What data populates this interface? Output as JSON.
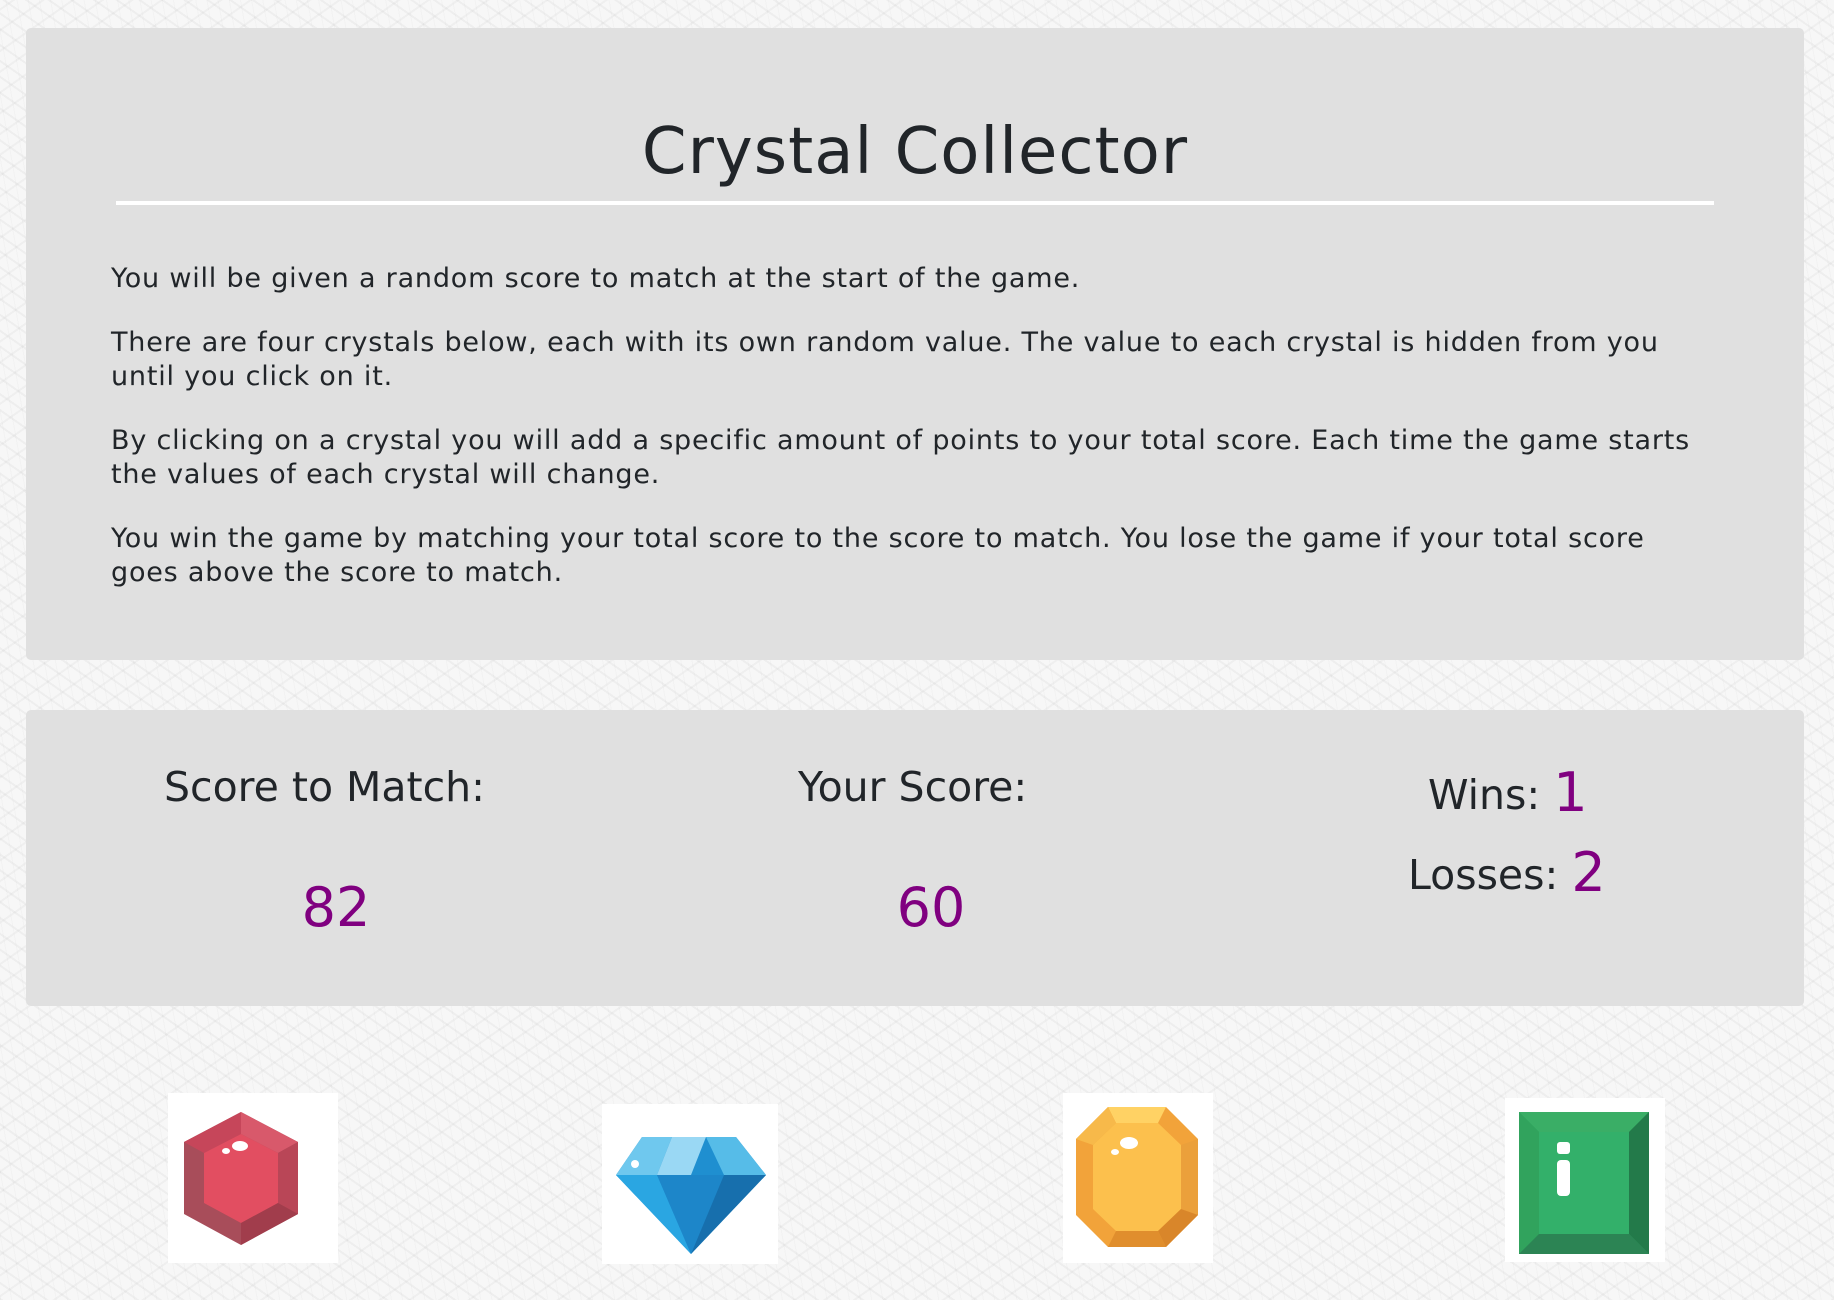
{
  "game": {
    "title": "Crystal Collector",
    "instructions": [
      "You will be given a random score to match at the start of the game.",
      "There are four crystals below, each with its own random value. The value to each crystal is hidden from you until you click on it.",
      "By clicking on a crystal you will add a specific amount of points to your total score. Each time the game starts the values of each crystal will change.",
      "You win the game by matching your total score to the score to match. You lose the game if your total score goes above the score to match."
    ]
  },
  "scoreboard": {
    "target_label": "Score to Match:",
    "target_value": "82",
    "score_label": "Your Score:",
    "score_value": "60",
    "wins_label": "Wins:",
    "wins_value": "1",
    "losses_label": "Losses:",
    "losses_value": "2"
  },
  "crystals": [
    {
      "name": "red-crystal",
      "color": "#e05263"
    },
    {
      "name": "blue-crystal",
      "color": "#3aaee0"
    },
    {
      "name": "yellow-crystal",
      "color": "#fbbd41"
    },
    {
      "name": "green-crystal",
      "color": "#2fa562"
    }
  ],
  "colors": {
    "value_accent": "#800080",
    "panel_bg": "#e0e0e0"
  }
}
